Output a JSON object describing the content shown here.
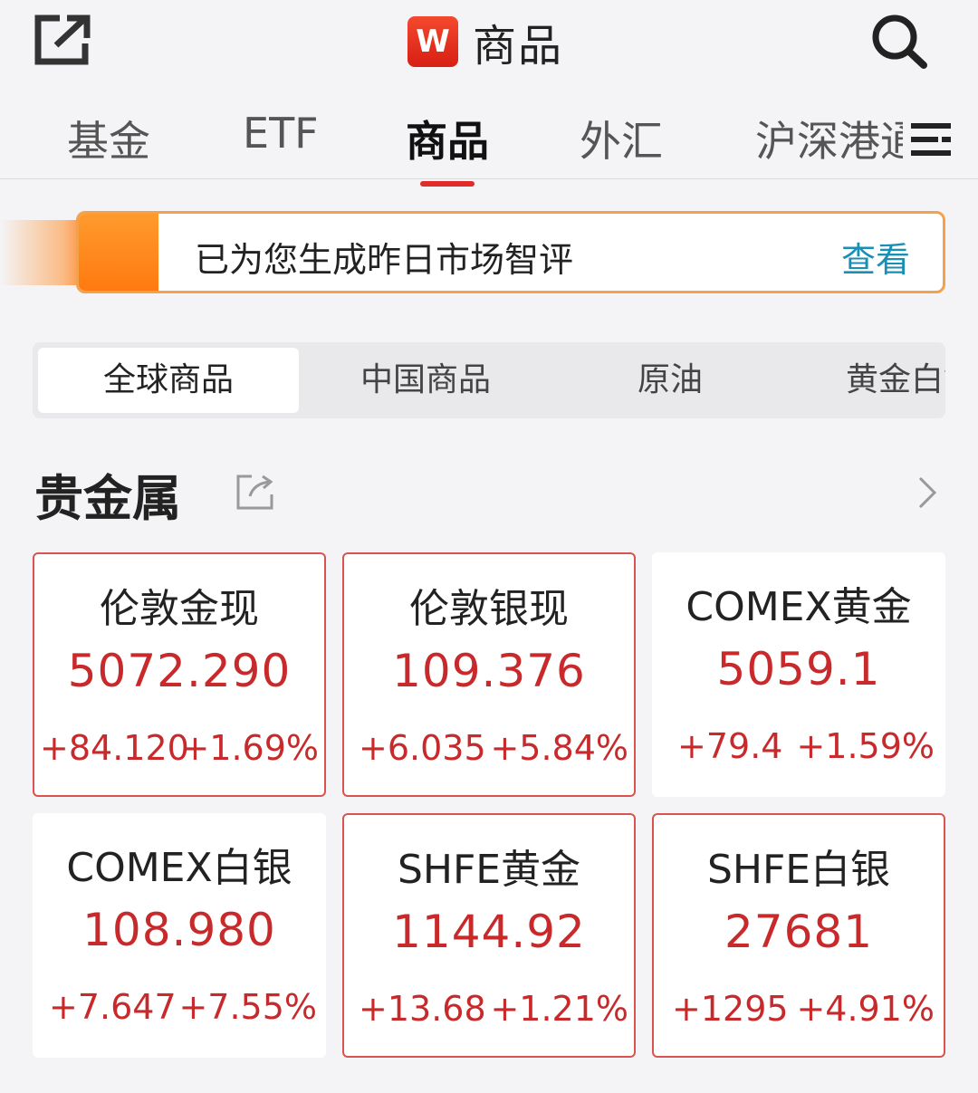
{
  "header": {
    "logo_text": "W",
    "title": "商品"
  },
  "category_tabs": [
    {
      "label": "基金"
    },
    {
      "label": "ETF"
    },
    {
      "label": "商品"
    },
    {
      "label": "外汇"
    },
    {
      "label": "沪深港通"
    }
  ],
  "banner": {
    "text": "已为您生成昨日市场智评",
    "link": "查看"
  },
  "sub_tabs": [
    {
      "label": "全球商品"
    },
    {
      "label": "中国商品"
    },
    {
      "label": "原油"
    },
    {
      "label": "黄金白银"
    }
  ],
  "section": {
    "title": "贵金属"
  },
  "cards": [
    {
      "name": "伦敦金现",
      "price": "5072.290",
      "change": "+84.120",
      "change_pct": "+1.69%"
    },
    {
      "name": "伦敦银现",
      "price": "109.376",
      "change": "+6.035",
      "change_pct": "+5.84%"
    },
    {
      "name": "COMEX黄金",
      "price": "5059.1",
      "change": "+79.4",
      "change_pct": "+1.59%"
    },
    {
      "name": "COMEX白银",
      "price": "108.980",
      "change": "+7.647",
      "change_pct": "+7.55%"
    },
    {
      "name": "SHFE黄金",
      "price": "1144.92",
      "change": "+13.68",
      "change_pct": "+1.21%"
    },
    {
      "name": "SHFE白银",
      "price": "27681",
      "change": "+1295",
      "change_pct": "+4.91%"
    }
  ],
  "colors": {
    "up": "#c8292b",
    "accent_underline": "#e12b2b",
    "banner_border": "#f3a14a",
    "link": "#1a8fb5"
  }
}
